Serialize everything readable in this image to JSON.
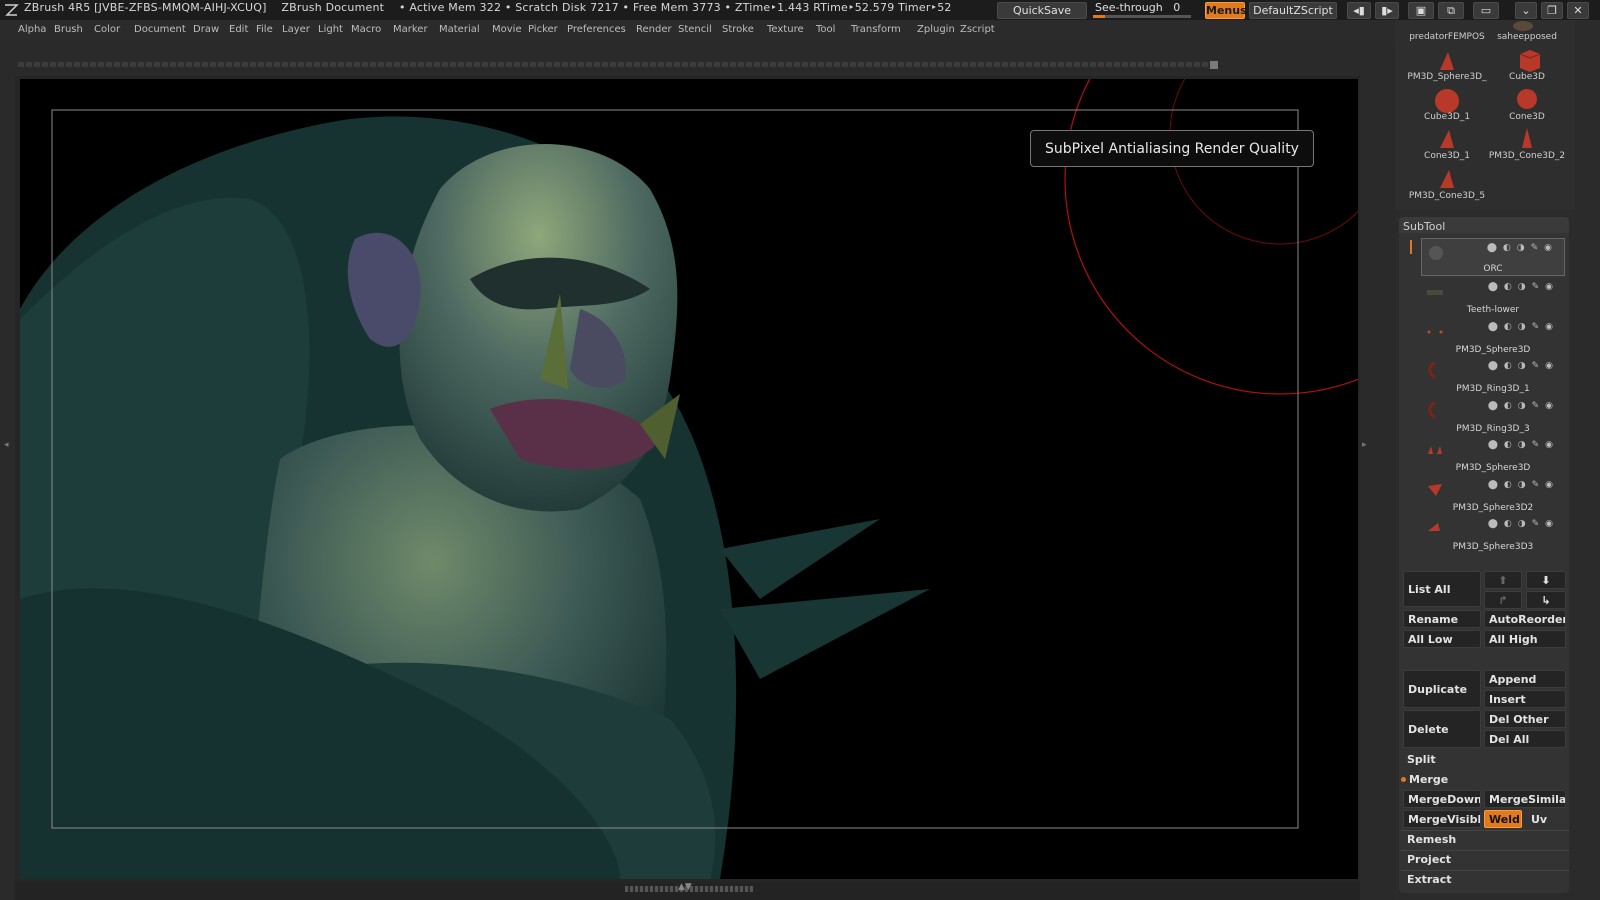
{
  "titlebar": {
    "app": "ZBrush 4R5 [JVBE-ZFBS-MMQM-AIHJ-XCUQ]",
    "document": "ZBrush Document",
    "stats": "• Active Mem 322 • Scratch Disk 7217 • Free Mem 3773 • ZTime‣1.443 RTime‣52.579 Timer‣52",
    "quicksave": "QuickSave",
    "seethrough": "See-through",
    "seethrough_value": "0",
    "seethrough_fraction": 0,
    "menus": "Menus",
    "default_zscript": "DefaultZScript",
    "accent_color": "#e07a1f"
  },
  "menu": [
    "Alpha",
    "Brush",
    "Color",
    "Document",
    "Draw",
    "Edit",
    "File",
    "Layer",
    "Light",
    "Macro",
    "Marker",
    "Material",
    "Movie",
    "Picker",
    "Preferences",
    "Render",
    "Stencil",
    "Stroke",
    "Texture",
    "Tool",
    "Transform",
    "Zplugin",
    "Zscript"
  ],
  "canvas": {
    "tooltip": "SubPixel Antialiasing Render Quality"
  },
  "tool_palette": {
    "items": [
      {
        "label": "predatorFEMPOS",
        "icon": "character-thumb-icon"
      },
      {
        "label": "saheepposed",
        "icon": "character-thumb-icon"
      },
      {
        "label": "PM3D_Sphere3D_",
        "icon": "cone-thumb-icon"
      },
      {
        "label": "Cube3D",
        "icon": "cube-thumb-icon"
      },
      {
        "label": "Cube3D_1",
        "icon": "sphere-thumb-icon"
      },
      {
        "label": "Cone3D",
        "icon": "sphere-thumb-icon"
      },
      {
        "label": "Cone3D_1",
        "icon": "cone-thumb-icon"
      },
      {
        "label": "PM3D_Cone3D_2",
        "icon": "cone-thumb-icon"
      },
      {
        "label": "PM3D_Cone3D_5",
        "icon": "cone-thumb-icon"
      }
    ]
  },
  "subtool": {
    "title": "SubTool",
    "items": [
      {
        "name": "ORC",
        "active": true
      },
      {
        "name": "Teeth-lower",
        "active": false
      },
      {
        "name": "PM3D_Sphere3D",
        "active": false
      },
      {
        "name": "PM3D_Ring3D_1",
        "active": false
      },
      {
        "name": "PM3D_Ring3D_3",
        "active": false
      },
      {
        "name": "PM3D_Sphere3D",
        "active": false
      },
      {
        "name": "PM3D_Sphere3D2",
        "active": false
      },
      {
        "name": "PM3D_Sphere3D3",
        "active": false
      }
    ],
    "list_all": "List All",
    "rename": "Rename",
    "autoreorder": "AutoReorder",
    "all_low": "All Low",
    "all_high": "All High",
    "duplicate": "Duplicate",
    "append": "Append",
    "insert": "Insert",
    "delete": "Delete",
    "del_other": "Del Other",
    "del_all": "Del All",
    "split": "Split",
    "merge": "Merge",
    "mergedown": "MergeDown",
    "mergesimilar": "MergeSimilar",
    "mergevisible": "MergeVisible",
    "weld": "Weld",
    "uv": "Uv",
    "remesh": "Remesh",
    "project": "Project",
    "extract": "Extract"
  }
}
